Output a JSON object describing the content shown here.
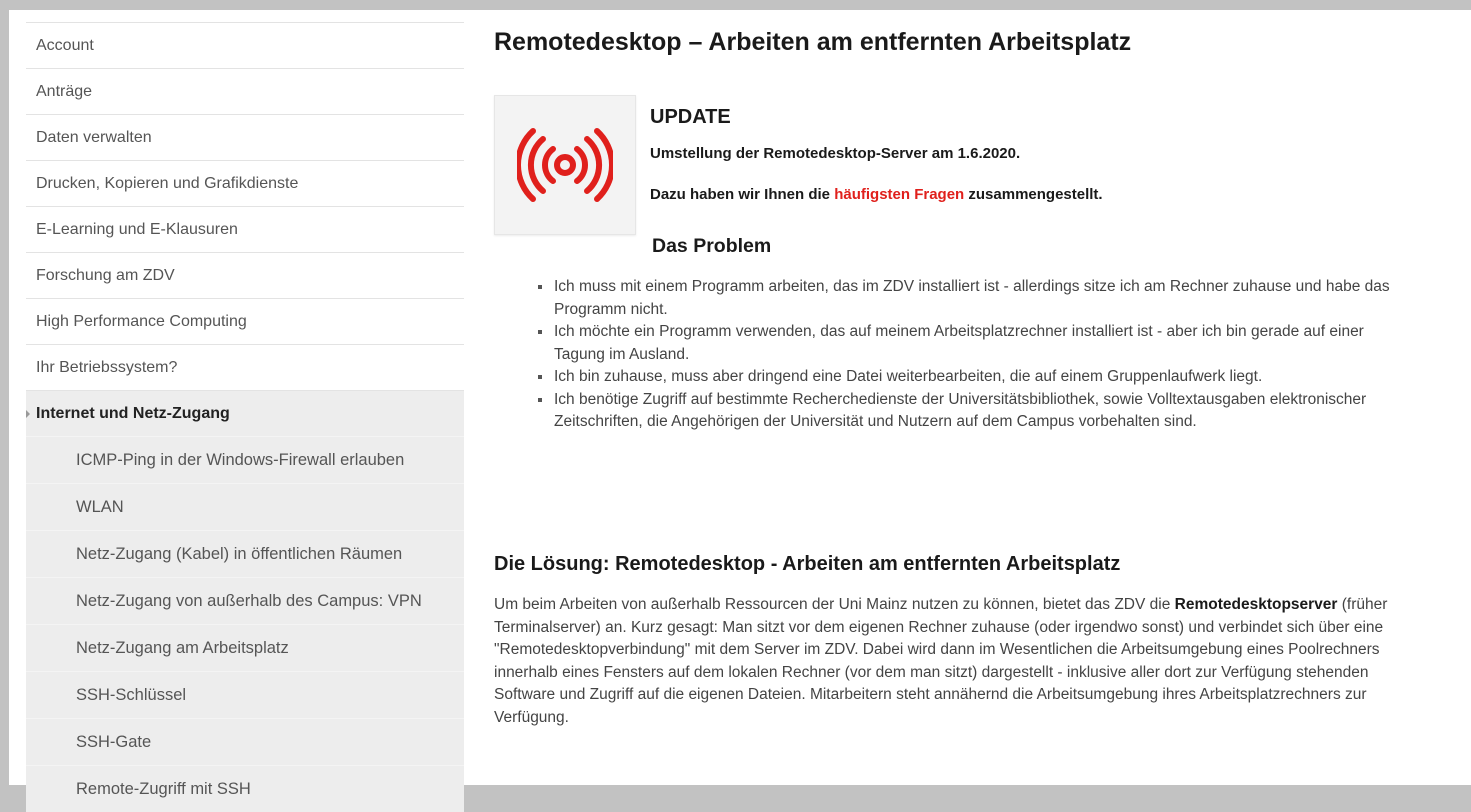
{
  "sidebar": {
    "items": [
      {
        "label": "Account"
      },
      {
        "label": "Anträge"
      },
      {
        "label": "Daten verwalten"
      },
      {
        "label": "Drucken, Kopieren und Grafikdienste"
      },
      {
        "label": "E-Learning und E-Klausuren"
      },
      {
        "label": "Forschung am ZDV"
      },
      {
        "label": "High Performance Computing"
      },
      {
        "label": "Ihr Betriebssystem?"
      }
    ],
    "active": {
      "label": "Internet und Netz-Zugang"
    },
    "subitems": [
      {
        "label": "ICMP-Ping in der Windows-Firewall erlauben"
      },
      {
        "label": "WLAN"
      },
      {
        "label": "Netz-Zugang (Kabel) in öffentlichen Räumen"
      },
      {
        "label": "Netz-Zugang von außerhalb des Campus: VPN"
      },
      {
        "label": "Netz-Zugang am Arbeitsplatz"
      },
      {
        "label": "SSH-Schlüssel"
      },
      {
        "label": "SSH-Gate"
      },
      {
        "label": "Remote-Zugriff mit SSH"
      }
    ]
  },
  "main": {
    "title": "Remotedesktop – Arbeiten am entfernten Arbeitsplatz",
    "update": {
      "heading": "UPDATE",
      "line1": "Umstellung der Remotedesktop-Server am 1.6.2020.",
      "line2_before": "Dazu haben wir Ihnen die ",
      "line2_link": "häufigsten Fragen",
      "line2_after": " zusammengestellt."
    },
    "problem": {
      "heading": "Das Problem",
      "items": [
        "Ich muss mit einem Programm arbeiten, das im ZDV installiert ist - allerdings sitze ich am Rechner zuhause und habe das Programm nicht.",
        "Ich möchte ein Programm verwenden, das auf meinem Arbeitsplatzrechner installiert ist - aber ich bin gerade auf einer Tagung im Ausland.",
        "Ich bin zuhause, muss aber dringend eine Datei weiterbearbeiten, die auf einem Gruppenlaufwerk liegt.",
        "Ich benötige Zugriff auf bestimmte Recherchedienste der Universitätsbibliothek, sowie Volltextausgaben elektronischer Zeitschriften, die Angehörigen der Universität und Nutzern auf dem Campus vorbehalten sind."
      ]
    },
    "solution": {
      "heading": "Die Lösung: Remotedesktop - Arbeiten am entfernten Arbeitsplatz",
      "p_before": "Um beim Arbeiten von außerhalb Ressourcen der Uni Mainz nutzen zu können, bietet das ZDV die ",
      "p_bold": "Remotedesktopserver",
      "p_after": " (früher Terminalserver) an. Kurz gesagt: Man sitzt vor dem eigenen Rechner zuhause (oder irgendwo sonst) und verbindet sich über eine \"Remotedesktopverbindung\" mit dem Server im ZDV. Dabei wird dann im Wesentlichen die Arbeitsumgebung eines Poolrechners innerhalb eines Fensters auf dem lokalen Rechner (vor dem man sitzt) dargestellt - inklusive aller dort zur Verfügung stehenden Software und Zugriff auf die eigenen Dateien. Mitarbeitern steht annähernd die Arbeitsumgebung ihres Arbeitsplatzrechners zur Verfügung."
    }
  },
  "colors": {
    "accent": "#e0201c",
    "page_bg": "#c2c2c2",
    "nav_active_bg": "#ededed"
  },
  "icons": {
    "update_icon": "broadcast-signal-icon",
    "active_caret": "caret-right-icon"
  }
}
